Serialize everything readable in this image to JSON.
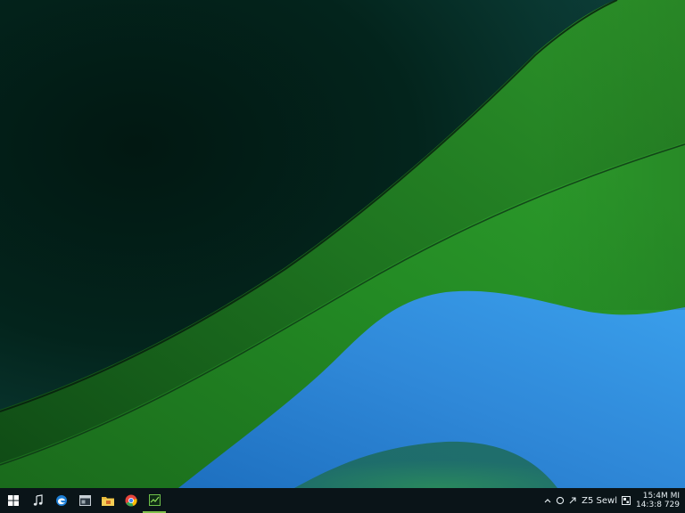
{
  "desktop": {
    "wallpaper": {
      "colors": {
        "dark": "#021812",
        "deep_teal": "#0d3a3a",
        "green": "#1f7a1f",
        "bright_green": "#2e9a2a",
        "blue": "#2f86d6",
        "light_blue": "#3c9ae6"
      }
    }
  },
  "taskbar": {
    "background": "#0a1418",
    "pinned": [
      {
        "icon": "windows-start-icon"
      },
      {
        "icon": "music-note-icon"
      },
      {
        "icon": "edge-browser-icon"
      },
      {
        "icon": "app-window-icon"
      },
      {
        "icon": "file-explorer-icon"
      },
      {
        "icon": "chrome-browser-icon"
      },
      {
        "icon": "task-manager-icon",
        "active": true
      }
    ],
    "tray": {
      "icons": [
        "chevron-up-icon",
        "circle-icon",
        "arrow-icon"
      ],
      "label": "Z5 Sewl",
      "notification_icon": "notification-icon",
      "clock": {
        "time": "15:4M MI",
        "date": "14:3:8 729"
      }
    }
  }
}
